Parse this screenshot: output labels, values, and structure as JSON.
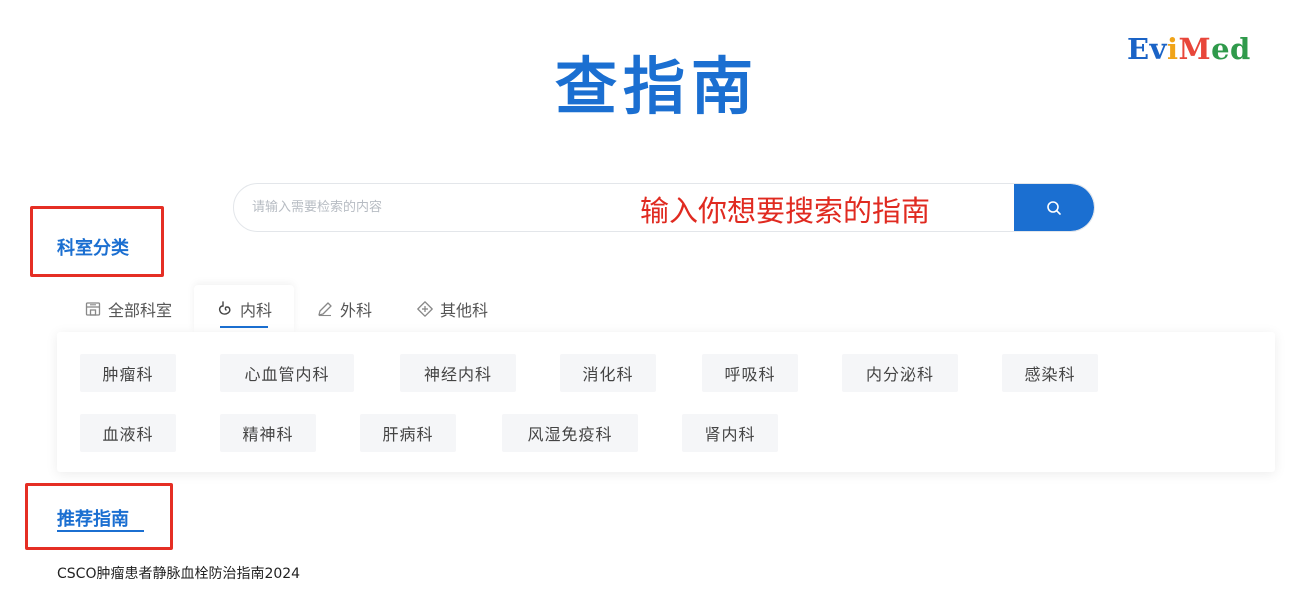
{
  "logo": {
    "part1": "Ev",
    "part2": "i",
    "part3": "M",
    "part4": "ed"
  },
  "page_title": "查指南",
  "search": {
    "placeholder": "请输入需要检索的内容",
    "annotation": "输入你想要搜索的指南"
  },
  "department_section": {
    "title": "科室分类",
    "tabs": [
      {
        "label": "全部科室",
        "icon": "building-icon",
        "active": false
      },
      {
        "label": "内科",
        "icon": "stomach-icon",
        "active": true
      },
      {
        "label": "外科",
        "icon": "scalpel-icon",
        "active": false
      },
      {
        "label": "其他科",
        "icon": "diamond-plus-icon",
        "active": false
      }
    ],
    "departments": [
      "肿瘤科",
      "心血管内科",
      "神经内科",
      "消化科",
      "呼吸科",
      "内分泌科",
      "感染科",
      "血液科",
      "精神科",
      "肝病科",
      "风湿免疫科",
      "肾内科"
    ]
  },
  "recommended_section": {
    "title": "推荐指南",
    "items": [
      "CSCO肿瘤患者静脉血栓防治指南2024"
    ]
  },
  "colors": {
    "accent": "#1b6fd1",
    "annotation_red": "#e02a20",
    "highlight_box": "#e52e24"
  }
}
